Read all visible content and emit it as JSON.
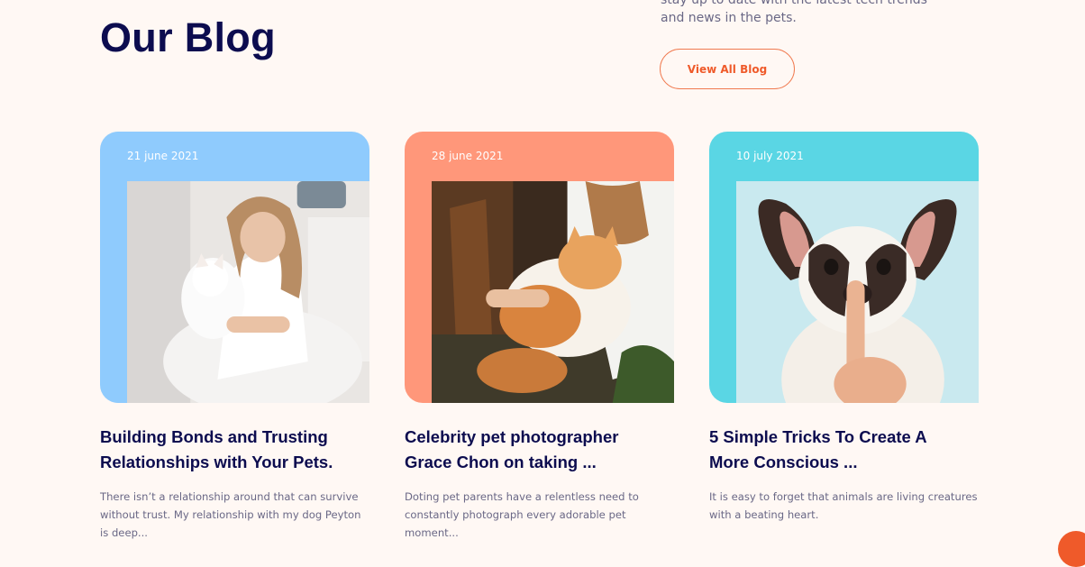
{
  "header": {
    "title": "Our Blog",
    "intro_line1": "stay up to date with the latest tech trends",
    "intro_line2": "and news in the pets.",
    "view_all_label": "View All Blog"
  },
  "colors": {
    "card1": "#8fcbfd",
    "card2": "#ff977a",
    "card3": "#5ad6e4",
    "accent": "#ef5a2a",
    "title": "#0c0c4f"
  },
  "posts": [
    {
      "date": "21 june 2021",
      "title": "Building Bonds and Trusting Relationships with Your Pets.",
      "excerpt": "There isn’t a relationship around that can survive without trust. My relationship with my dog Peyton is deep..."
    },
    {
      "date": "28 june 2021",
      "title": "Celebrity pet photographer Grace Chon on taking ...",
      "excerpt": "Doting pet parents have a relentless need to constantly photograph every adorable pet moment..."
    },
    {
      "date": "10 july 2021",
      "title": "5 Simple Tricks To Create A More Conscious ...",
      "excerpt": "It is easy to forget that animals are living creatures with a beating heart."
    }
  ]
}
